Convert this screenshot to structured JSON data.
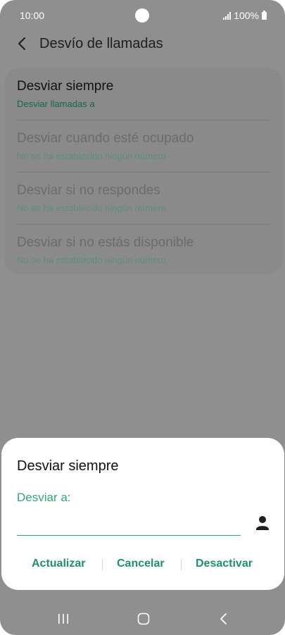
{
  "status_bar": {
    "time": "10:00",
    "battery": "100%"
  },
  "app_bar": {
    "title": "Desvío de llamadas"
  },
  "settings": [
    {
      "title": "Desviar siempre",
      "subtitle": "Desviar llamadas a"
    },
    {
      "title": "Desviar cuando esté ocupado",
      "subtitle": "No se ha establecido ningún número"
    },
    {
      "title": "Desviar si no respondes",
      "subtitle": "No se ha establecido ningún número"
    },
    {
      "title": "Desviar si no estás disponible",
      "subtitle": "No se ha establecido ningún número"
    }
  ],
  "dialog": {
    "title": "Desviar siempre",
    "field_label": "Desviar a:",
    "field_value": "",
    "actions": {
      "update": "Actualizar",
      "cancel": "Cancelar",
      "deactivate": "Desactivar"
    }
  },
  "icons": {
    "back": "chevron-left-icon",
    "contact": "person-icon",
    "nav_recents": "recents-icon",
    "nav_home": "home-icon",
    "nav_back": "back-icon"
  },
  "colors": {
    "accent": "#2fa877",
    "action_text": "#1f9168",
    "scrim": "#8f8f8f",
    "dialog_bg": "#ffffff"
  }
}
